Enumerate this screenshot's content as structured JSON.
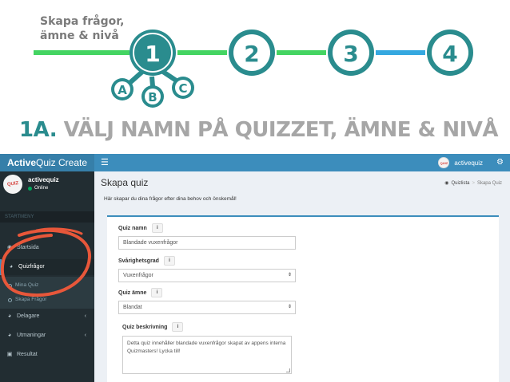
{
  "steps": {
    "caption_line1": "Skapa frågor,",
    "caption_line2": "ämne & nivå",
    "numbers": [
      "1",
      "2",
      "3",
      "4"
    ],
    "substeps": [
      "A",
      "B",
      "C"
    ],
    "title_number": "1A.",
    "title_text": "VÄLJ NAMN PÅ QUIZZET, ÄMNE & NIVÅ",
    "colors": {
      "teal": "#2a8c8e",
      "green": "#44d462",
      "blue": "#35a8e0",
      "title_gray": "#a6a6a6"
    }
  },
  "topbar": {
    "brand_bold": "Active",
    "brand_rest": "Quiz Create",
    "menu_icon": "hamburger-icon",
    "username": "activequiz",
    "settings_icon": "gears-icon",
    "color": "#3c8dbc"
  },
  "sidebar": {
    "avatar_text": "QUIZ",
    "user_name": "activequiz",
    "status": "Online",
    "header": "STARTMENY",
    "items": [
      {
        "label": "Startsida",
        "icon": "dashboard-icon"
      },
      {
        "label": "Quizfrågor",
        "icon": "pie-chart-icon"
      },
      {
        "label": "Delagare",
        "icon": "pie-chart-icon"
      },
      {
        "label": "Utmaningar",
        "icon": "pie-chart-icon"
      },
      {
        "label": "Resultat",
        "icon": "laptop-icon"
      }
    ],
    "submenu": [
      {
        "label": "Mina Quiz"
      },
      {
        "label": "Skapa Frågor"
      }
    ]
  },
  "content": {
    "title": "Skapa quiz",
    "breadcrumb": [
      "Quizlista",
      ">",
      "Skapa Quiz"
    ],
    "description": "Här skapar du dina frågor efter dina behov och önskemål!",
    "form": {
      "name_label": "Quiz namn",
      "name_value": "Blandade vuxenfrågor",
      "difficulty_label": "Svårighetsgrad",
      "difficulty_value": "Vuxenfrågor",
      "subject_label": "Quiz ämne",
      "subject_value": "Blandat",
      "description_label": "Quiz beskrivning",
      "description_value": "Detta quiz innehåller blandade vuxenfrågor skapat av appens interna Quizmasters! Lycka till!",
      "info_glyph": "i"
    }
  },
  "annotation": {
    "color": "#e8573a"
  }
}
